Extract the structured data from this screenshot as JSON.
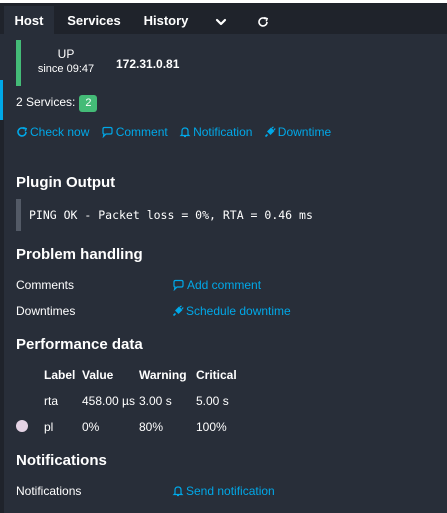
{
  "tabs": [
    {
      "label": "Host"
    },
    {
      "label": "Services"
    },
    {
      "label": "History"
    }
  ],
  "host": {
    "state": "UP",
    "since": "since 09:47",
    "address": "172.31.0.81",
    "state_color": "#44bb77"
  },
  "services_summary": {
    "label": "2 Services:",
    "count": "2"
  },
  "actions": {
    "check_now": "Check now",
    "comment": "Comment",
    "notification": "Notification",
    "downtime": "Downtime"
  },
  "plugin_output": {
    "title": "Plugin Output",
    "text": "PING OK - Packet loss = 0%, RTA = 0.46 ms"
  },
  "problem_handling": {
    "title": "Problem handling",
    "comments_label": "Comments",
    "add_comment": "Add comment",
    "downtimes_label": "Downtimes",
    "schedule_downtime": "Schedule downtime"
  },
  "performance": {
    "title": "Performance data",
    "headers": {
      "label": "Label",
      "value": "Value",
      "warning": "Warning",
      "critical": "Critical"
    },
    "rows": [
      {
        "label": "rta",
        "value": "458.00 µs",
        "warning": "3.00 s",
        "critical": "5.00 s"
      },
      {
        "label": "pl",
        "value": "0%",
        "warning": "80%",
        "critical": "100%"
      }
    ]
  },
  "notifications": {
    "title": "Notifications",
    "label": "Notifications",
    "send": "Send notification"
  },
  "colors": {
    "accent": "#00a8e8",
    "ok": "#44bb77",
    "background": "#282e39"
  },
  "icons": [
    "chevron-down-icon",
    "refresh-icon",
    "refresh-check-icon",
    "comment-icon",
    "bell-icon",
    "plug-icon"
  ]
}
